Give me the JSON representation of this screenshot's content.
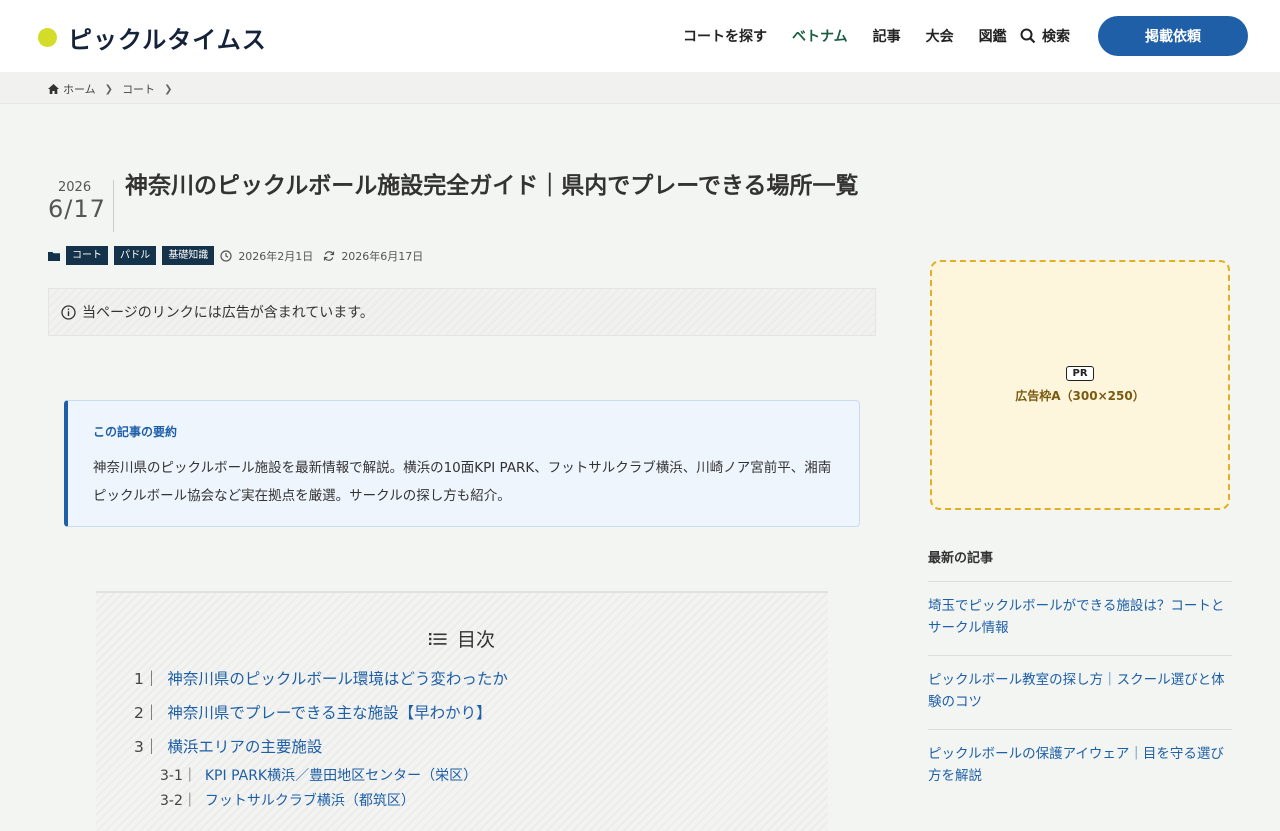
{
  "header": {
    "logo": "ピックルタイムス",
    "nav": [
      "コートを探す",
      "ベトナム",
      "記事",
      "大会",
      "図鑑"
    ],
    "search_label": "検索",
    "cta": "掲載依頼",
    "accent_color": "#1e5fa8",
    "logo_dot_color": "#d4dc2a"
  },
  "breadcrumb": [
    "ホーム",
    "コート"
  ],
  "post": {
    "date_year": "2026",
    "date_md": "6/17",
    "title": "神奈川のピックルボール施設完全ガイド｜県内でプレーできる場所一覧",
    "categories": [
      "コート",
      "パドル",
      "基礎知識"
    ],
    "published": "2026年2月1日",
    "updated": "2026年6月17日",
    "notice": "当ページのリンクには広告が含まれています。",
    "summary_heading": "この記事の要約",
    "summary_body": "神奈川県のピックルボール施設を最新情報で解説。横浜の10面KPI PARK、フットサルクラブ横浜、川崎ノア宮前平、湘南ピックルボール協会など実在拠点を厳選。サークルの探し方も紹介。"
  },
  "toc": {
    "title": "目次",
    "items": [
      {
        "num": "1｜",
        "label": "神奈川県のピックルボール環境はどう変わったか"
      },
      {
        "num": "2｜",
        "label": "神奈川県でプレーできる主な施設【早わかり】"
      },
      {
        "num": "3｜",
        "label": "横浜エリアの主要施設"
      }
    ],
    "subitems": [
      {
        "num": "3-1｜",
        "label": "KPI PARK横浜／豊田地区センター（栄区）"
      },
      {
        "num": "3-2｜",
        "label": "フットサルクラブ横浜（都筑区）"
      }
    ]
  },
  "sidebar": {
    "ad_badge": "PR",
    "ad_label": "広告枠A（300×250）",
    "recent_heading": "最新の記事",
    "recent": [
      "埼玉でピックルボールができる施設は？コートとサークル情報",
      "ピックルボール教室の探し方｜スクール選びと体験のコツ",
      "ピックルボールの保護アイウェア｜目を守る選び方を解説"
    ]
  }
}
